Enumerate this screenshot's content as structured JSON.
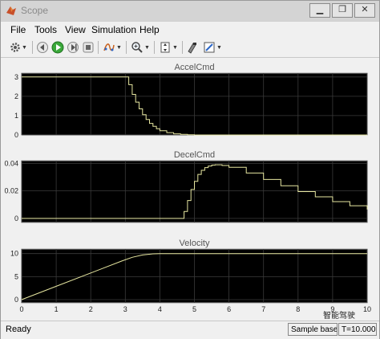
{
  "window": {
    "title": "Scope"
  },
  "menu": [
    "File",
    "Tools",
    "View",
    "Simulation",
    "Help"
  ],
  "toolbar": {
    "icons": [
      "gear-icon",
      "rewind-step-icon",
      "run-icon",
      "step-forward-icon",
      "stop-icon",
      "sample-time-icon",
      "zoom-icon",
      "fit-axes-icon",
      "style-icon",
      "highlight-icon"
    ]
  },
  "chart_data": [
    {
      "type": "line",
      "title": "AccelCmd",
      "xlim": [
        0,
        10
      ],
      "ylim": [
        0,
        3.2
      ],
      "xticks": [
        0,
        1,
        2,
        3,
        4,
        5,
        6,
        7,
        8,
        9,
        10
      ],
      "yticks": [
        0,
        1,
        2,
        3
      ],
      "ytick_labels": [
        "0",
        "1",
        "2",
        "3"
      ],
      "x_tick_labels_shown": false,
      "grid": true,
      "series": [
        {
          "color": "#e6e6a0",
          "step": true,
          "x": [
            0,
            2.9,
            3.0,
            3.1,
            3.2,
            3.3,
            3.4,
            3.5,
            3.6,
            3.7,
            3.8,
            3.9,
            4.0,
            4.2,
            4.4,
            4.6,
            4.8,
            5.0,
            5.5,
            10
          ],
          "y": [
            3,
            3,
            3,
            2.6,
            2.1,
            1.7,
            1.35,
            1.05,
            0.8,
            0.6,
            0.45,
            0.32,
            0.22,
            0.12,
            0.06,
            0.03,
            0.01,
            0,
            0,
            0
          ]
        }
      ]
    },
    {
      "type": "line",
      "title": "DecelCmd",
      "xlim": [
        0,
        10
      ],
      "ylim": [
        -0.003,
        0.042
      ],
      "xticks": [
        0,
        1,
        2,
        3,
        4,
        5,
        6,
        7,
        8,
        9,
        10
      ],
      "yticks": [
        0,
        0.02,
        0.04
      ],
      "ytick_labels": [
        "0",
        "0.02",
        "0.04"
      ],
      "x_tick_labels_shown": false,
      "grid": true,
      "series": [
        {
          "color": "#e6e6a0",
          "step": true,
          "x": [
            0,
            4.6,
            4.7,
            4.8,
            4.9,
            5.0,
            5.1,
            5.2,
            5.3,
            5.4,
            5.5,
            5.6,
            5.8,
            6.0,
            6.5,
            7.0,
            7.5,
            8.0,
            8.5,
            9.0,
            9.5,
            10
          ],
          "y": [
            0,
            0,
            0.005,
            0.013,
            0.021,
            0.027,
            0.032,
            0.035,
            0.037,
            0.038,
            0.0388,
            0.039,
            0.0385,
            0.0372,
            0.033,
            0.0283,
            0.0237,
            0.0195,
            0.0157,
            0.0122,
            0.0092,
            0.0065
          ]
        }
      ]
    },
    {
      "type": "line",
      "title": "Velocity",
      "xlim": [
        0,
        10
      ],
      "ylim": [
        -0.7,
        11
      ],
      "xticks": [
        0,
        1,
        2,
        3,
        4,
        5,
        6,
        7,
        8,
        9,
        10
      ],
      "yticks": [
        0,
        5,
        10
      ],
      "ytick_labels": [
        "0",
        "5",
        "10"
      ],
      "x_tick_labels_shown": true,
      "grid": true,
      "series": [
        {
          "color": "#e6e6a0",
          "step": false,
          "x": [
            0,
            1,
            2,
            2.9,
            3.2,
            3.5,
            3.8,
            4.0,
            4.2,
            10
          ],
          "y": [
            0,
            2.9,
            5.8,
            8.4,
            9.2,
            9.7,
            9.95,
            10,
            10,
            10
          ]
        }
      ]
    }
  ],
  "status": {
    "ready": "Ready",
    "sample": "Sample based",
    "time": "T=10.000"
  },
  "watermark": "智能驾驶"
}
